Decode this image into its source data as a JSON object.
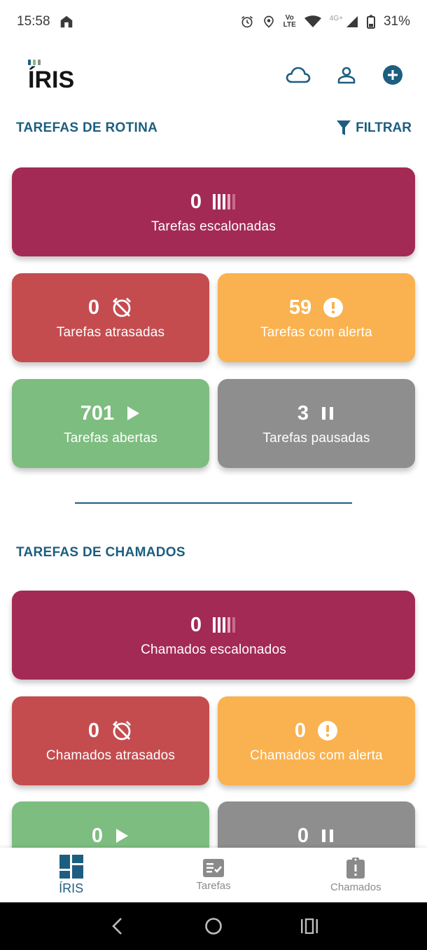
{
  "status_bar": {
    "time": "15:58",
    "battery": "31%",
    "network": "4G+",
    "volte_top": "Vo",
    "volte_bottom": "LTE"
  },
  "app": {
    "logo": "ÍRIS"
  },
  "routine": {
    "title": "TAREFAS DE ROTINA",
    "filter_label": "FILTRAR",
    "escalonadas": {
      "count": "0",
      "label": "Tarefas escalonadas"
    },
    "atrasadas": {
      "count": "0",
      "label": "Tarefas atrasadas"
    },
    "alerta": {
      "count": "59",
      "label": "Tarefas com alerta"
    },
    "abertas": {
      "count": "701",
      "label": "Tarefas abertas"
    },
    "pausadas": {
      "count": "3",
      "label": "Tarefas pausadas"
    }
  },
  "calls": {
    "title": "TAREFAS DE CHAMADOS",
    "escalonados": {
      "count": "0",
      "label": "Chamados escalonados"
    },
    "atrasados": {
      "count": "0",
      "label": "Chamados atrasados"
    },
    "alerta": {
      "count": "0",
      "label": "Chamados com alerta"
    },
    "abertos": {
      "count": "0"
    },
    "pausados": {
      "count": "0"
    }
  },
  "bottom_nav": [
    {
      "label": "ÍRIS",
      "icon": "dashboard-icon",
      "active": true
    },
    {
      "label": "Tarefas",
      "icon": "task-list-icon",
      "active": false
    },
    {
      "label": "Chamados",
      "icon": "clipboard-alert-icon",
      "active": false
    }
  ],
  "colors": {
    "primary": "#1d5e80",
    "escalonadas": "#a32a54",
    "atrasadas": "#c44c4f",
    "alerta": "#f9b24f",
    "abertas": "#7dbd80",
    "pausadas": "#8e8e8e"
  }
}
